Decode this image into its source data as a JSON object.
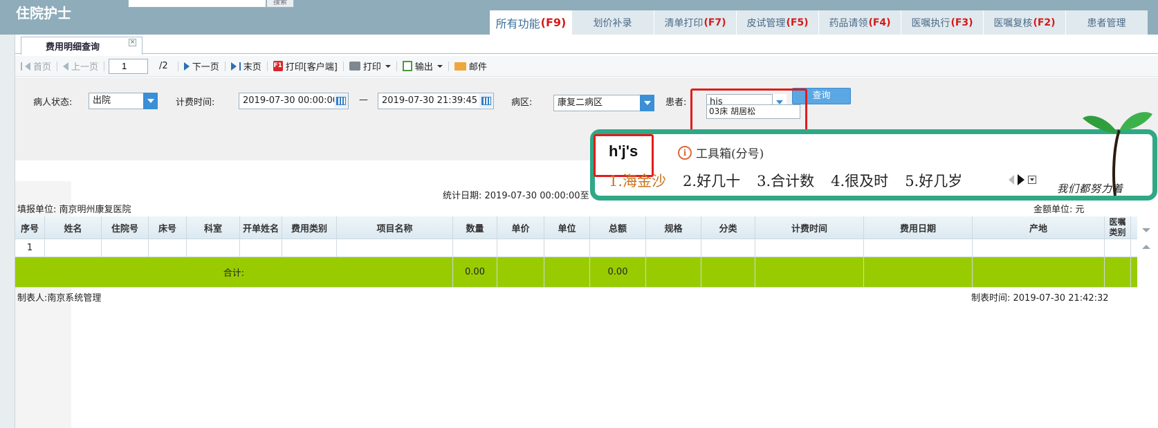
{
  "header": {
    "app_title": "住院护士",
    "search_button": "搜索",
    "tabs": [
      {
        "label": "所有功能",
        "key": "(F9)",
        "active": true
      },
      {
        "label": "划价补录",
        "key": ""
      },
      {
        "label": "清单打印",
        "key": "(F7)"
      },
      {
        "label": "皮试管理",
        "key": "(F5)"
      },
      {
        "label": "药品请领",
        "key": "(F4)"
      },
      {
        "label": "医嘱执行",
        "key": "(F3)"
      },
      {
        "label": "医嘱复核",
        "key": "(F2)"
      },
      {
        "label": "患者管理",
        "key": ""
      }
    ]
  },
  "page_tab": {
    "label": "费用明细查询",
    "close": "×"
  },
  "toolbar": {
    "first": "首页",
    "prev": "上一页",
    "page_value": "1",
    "page_total": "/2",
    "next": "下一页",
    "last": "末页",
    "print_client": "打印[客户端]",
    "print_pdf_badge": "PDF",
    "print": "打印",
    "export": "输出",
    "mail": "邮件"
  },
  "filters": {
    "status_label": "病人状态:",
    "status_value": "出院",
    "time_label": "计费时间:",
    "time_from": "2019-07-30 00:00:00",
    "dash": "—",
    "time_to": "2019-07-30 21:39:45",
    "ward_label": "病区:",
    "ward_value": "康复二病区",
    "patient_label": "患者:",
    "patient_value": "hjs",
    "patient_option": "03床 胡居松",
    "query_button": "查询"
  },
  "report": {
    "stat_date": "统计日期: 2019-07-30 00:00:00至",
    "unit_label": "填报单位: 南京明州康复医院",
    "amount_unit": "金额单位: 元",
    "columns": [
      "序号",
      "姓名",
      "住院号",
      "床号",
      "科室",
      "开单姓名",
      "费用类别",
      "项目名称",
      "数量",
      "单价",
      "单位",
      "总额",
      "规格",
      "分类",
      "计费时间",
      "费用日期",
      "产地",
      "医嘱\n类别"
    ],
    "row1_index": "1",
    "total_label": "合计:",
    "total_qty": "0.00",
    "total_amount": "0.00",
    "maker": "制表人:南京系统管理",
    "make_time": "制表时间: 2019-07-30 21:42:32"
  },
  "ime": {
    "pinyin": "h'j's",
    "toolbox": "工具箱(分号)",
    "info_icon": "i",
    "candidates": [
      "1.海金沙",
      "2.好几十",
      "3.合计数",
      "4.很及时",
      "5.好几岁"
    ],
    "brand_text": "我们都努力着"
  },
  "colors": {
    "header_bg": "#8eacb9",
    "accent_blue": "#3a8fd6",
    "total_row_green": "#99cc00",
    "ime_border": "#2fa886",
    "highlight_red": "#e21b1b"
  }
}
